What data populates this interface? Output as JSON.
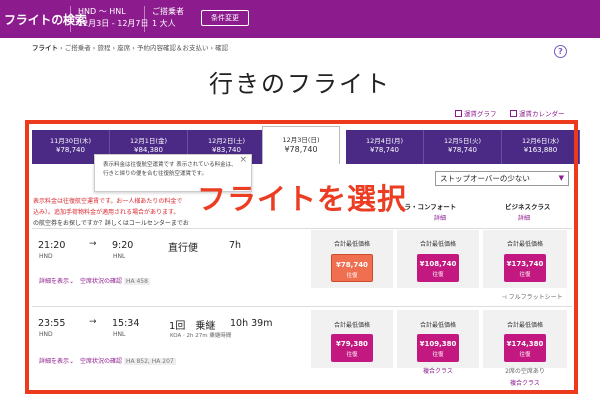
{
  "header": {
    "brand": "フライトの検索",
    "route": "HND 〜 HNL",
    "dates": "12月3日 - 12月7日",
    "passengers_label": "ご搭乗者",
    "passengers_value": "1 大人",
    "change_button": "条件変更"
  },
  "breadcrumb": {
    "current": "フライト",
    "rest": "› ご搭乗者 › 旅程 › 座席 › 予約内容確認＆お支払い › 確認"
  },
  "page_title": "行きのフライト",
  "tools": {
    "price_graph": "運賃グラフ",
    "calendar": "運賃カレンダー"
  },
  "date_tabs": [
    {
      "date": "11月30日(木)",
      "price": "¥78,740"
    },
    {
      "date": "12月1日(金)",
      "price": "¥84,380"
    },
    {
      "date": "12月2日(土)",
      "price": "¥83,740"
    },
    {
      "date": "12月3日(日)",
      "price": "¥78,740"
    },
    {
      "date": "12月4日(月)",
      "price": "¥78,740"
    },
    {
      "date": "12月5日(火)",
      "price": "¥78,740"
    },
    {
      "date": "12月6日(水)",
      "price": "¥163,880"
    }
  ],
  "tooltip": {
    "line1": "表示料金は往復航空運賃です 表示されている料金は、",
    "line2": "行きと帰りの便を合む往復航空運賃です。"
  },
  "notice": {
    "line1": "表示料金は往復航空運賃です。お一人様あたりの料金で",
    "line2": "込み）。追加手荷物料金が適用される場合があります。",
    "line3": "の航空券をお探しですか？詳しくはコールセンターまでお"
  },
  "sort": {
    "selected": "ストップオーバーの少ない"
  },
  "columns": {
    "extra_comfort": "トラ・コンフォート",
    "extra_comfort_link": "詳細",
    "business": "ビジネスクラス",
    "business_link": "詳細"
  },
  "overlay_caption": "フライトを選択",
  "flights": [
    {
      "depart": "21:20",
      "depart_ap": "HND",
      "arrive": "9:20",
      "arrive_ap": "HNL",
      "type": "直行便",
      "duration": "7h",
      "sub": "",
      "links": "詳細を表示⌄　空席状況の確認",
      "flight_no": "HA 458",
      "prices": [
        {
          "label": "合計最低価格",
          "value": "¥78,740",
          "trip": "往復"
        },
        {
          "label": "合計最低価格",
          "value": "¥108,740",
          "trip": "往復"
        },
        {
          "label": "合計最低価格",
          "value": "¥173,740",
          "trip": "往復"
        }
      ],
      "note_business": "フルフラットシート"
    },
    {
      "depart": "23:55",
      "depart_ap": "HND",
      "arrive": "15:34",
      "arrive_ap": "HNL",
      "type": "1回　乗継",
      "duration": "10h 39m",
      "sub": "KOA · 2h 27m 乗継時間",
      "links": "詳細を表示⌄　空席状況の確認",
      "flight_no": "HA 852, HA 207",
      "prices": [
        {
          "label": "合計最低価格",
          "value": "¥79,380",
          "trip": "往復"
        },
        {
          "label": "合計最低価格",
          "value": "¥109,380",
          "trip": "往復"
        },
        {
          "label": "合計最低価格",
          "value": "¥174,380",
          "trip": "往復"
        }
      ],
      "note_comfort": "複合クラス",
      "note_business_1": "2席の空席あり",
      "note_business_2": "複合クラス"
    }
  ],
  "colors": {
    "brand": "#8c1b8e",
    "tab_bg": "#4b2a86",
    "price": "#c2187f",
    "highlight": "#ee3a1c",
    "cheapest": "#f06f50"
  }
}
